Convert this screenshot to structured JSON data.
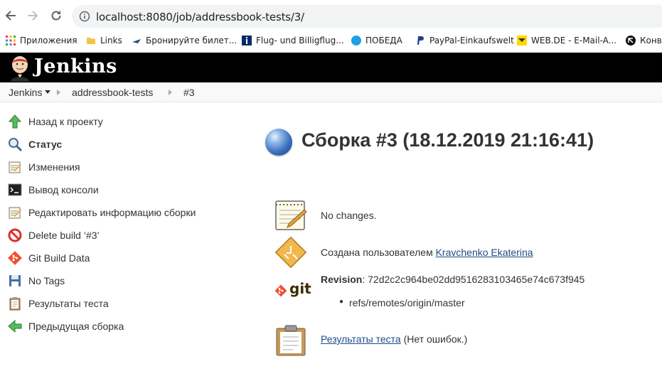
{
  "browser": {
    "url": "localhost:8080/job/addressbook-tests/3/",
    "bookmarks": [
      {
        "label": "Приложения",
        "icon": "apps-grid-icon"
      },
      {
        "label": "Links",
        "icon": "folder-icon"
      },
      {
        "label": "Бронируйте билет...",
        "icon": "airline-icon"
      },
      {
        "label": "Flug- und Billigflug...",
        "icon": "flight-info-icon"
      },
      {
        "label": "ПОБЕДА",
        "icon": "pobeda-icon"
      },
      {
        "label": "PayPal-Einkaufswelt",
        "icon": "paypal-icon"
      },
      {
        "label": "WEB.DE - E-Mail-A...",
        "icon": "webde-icon"
      },
      {
        "label": "Конв",
        "icon": "converter-icon"
      }
    ]
  },
  "header": {
    "app_name": "Jenkins"
  },
  "breadcrumbs": [
    "Jenkins",
    "addressbook-tests",
    "#3"
  ],
  "sidebar": {
    "items": [
      {
        "label": "Назад к проекту",
        "icon": "up-arrow-icon"
      },
      {
        "label": "Статус",
        "icon": "magnifier-icon"
      },
      {
        "label": "Изменения",
        "icon": "notepad-icon"
      },
      {
        "label": "Вывод консоли",
        "icon": "terminal-icon"
      },
      {
        "label": "Редактировать информацию сборки",
        "icon": "notepad-edit-icon"
      },
      {
        "label": "Delete build ‘#3’",
        "icon": "no-entry-icon"
      },
      {
        "label": "Git Build Data",
        "icon": "git-diamond-icon"
      },
      {
        "label": "No Tags",
        "icon": "save-disk-icon"
      },
      {
        "label": "Результаты теста",
        "icon": "clipboard-icon"
      },
      {
        "label": "Предыдущая сборка",
        "icon": "left-arrow-icon"
      }
    ]
  },
  "main": {
    "title": "Сборка #3 (18.12.2019 21:16:41)",
    "changes_text": "No changes.",
    "created_by_prefix": "Создана пользователем",
    "created_by_user": "Kravchenko Ekaterina",
    "revision_label": "Revision",
    "revision_hash": ": 72d2c2c964be02dd9516283103465e74c673f945",
    "refs": [
      "refs/remotes/origin/master"
    ],
    "git_logo_text": "git",
    "test_results_link": "Результаты теста",
    "test_results_suffix": " (Нет ошибок.)"
  },
  "colors": {
    "header_bg": "#000000",
    "link": "#204a87",
    "git_orange": "#f05033",
    "status_blue": "#3a6fc0"
  }
}
